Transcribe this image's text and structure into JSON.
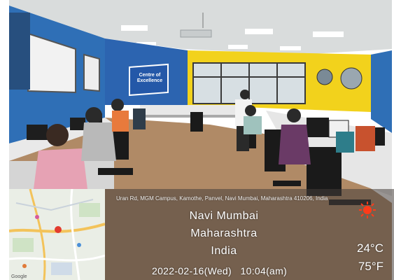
{
  "sign": {
    "line1": "Centre of",
    "line2": "Excellence"
  },
  "geotag": {
    "address": "Uran Rd, MGM Campus, Kamothe, Panvel, Navi Mumbai, Maharashtra 410206, India",
    "city": "Navi Mumbai",
    "state": "Maharashtra",
    "country": "India",
    "datetime": "2022-02-16(Wed)   10:04(am)",
    "temp_c": "24°C",
    "temp_f": "75°F",
    "weather_icon": "sun-icon"
  },
  "map": {
    "brand": "Google"
  },
  "colors": {
    "wall_blue": "#2f6fb6",
    "wall_yellow": "#f2d21c",
    "floor": "#b08a66",
    "sun": "#ff3b1a"
  }
}
